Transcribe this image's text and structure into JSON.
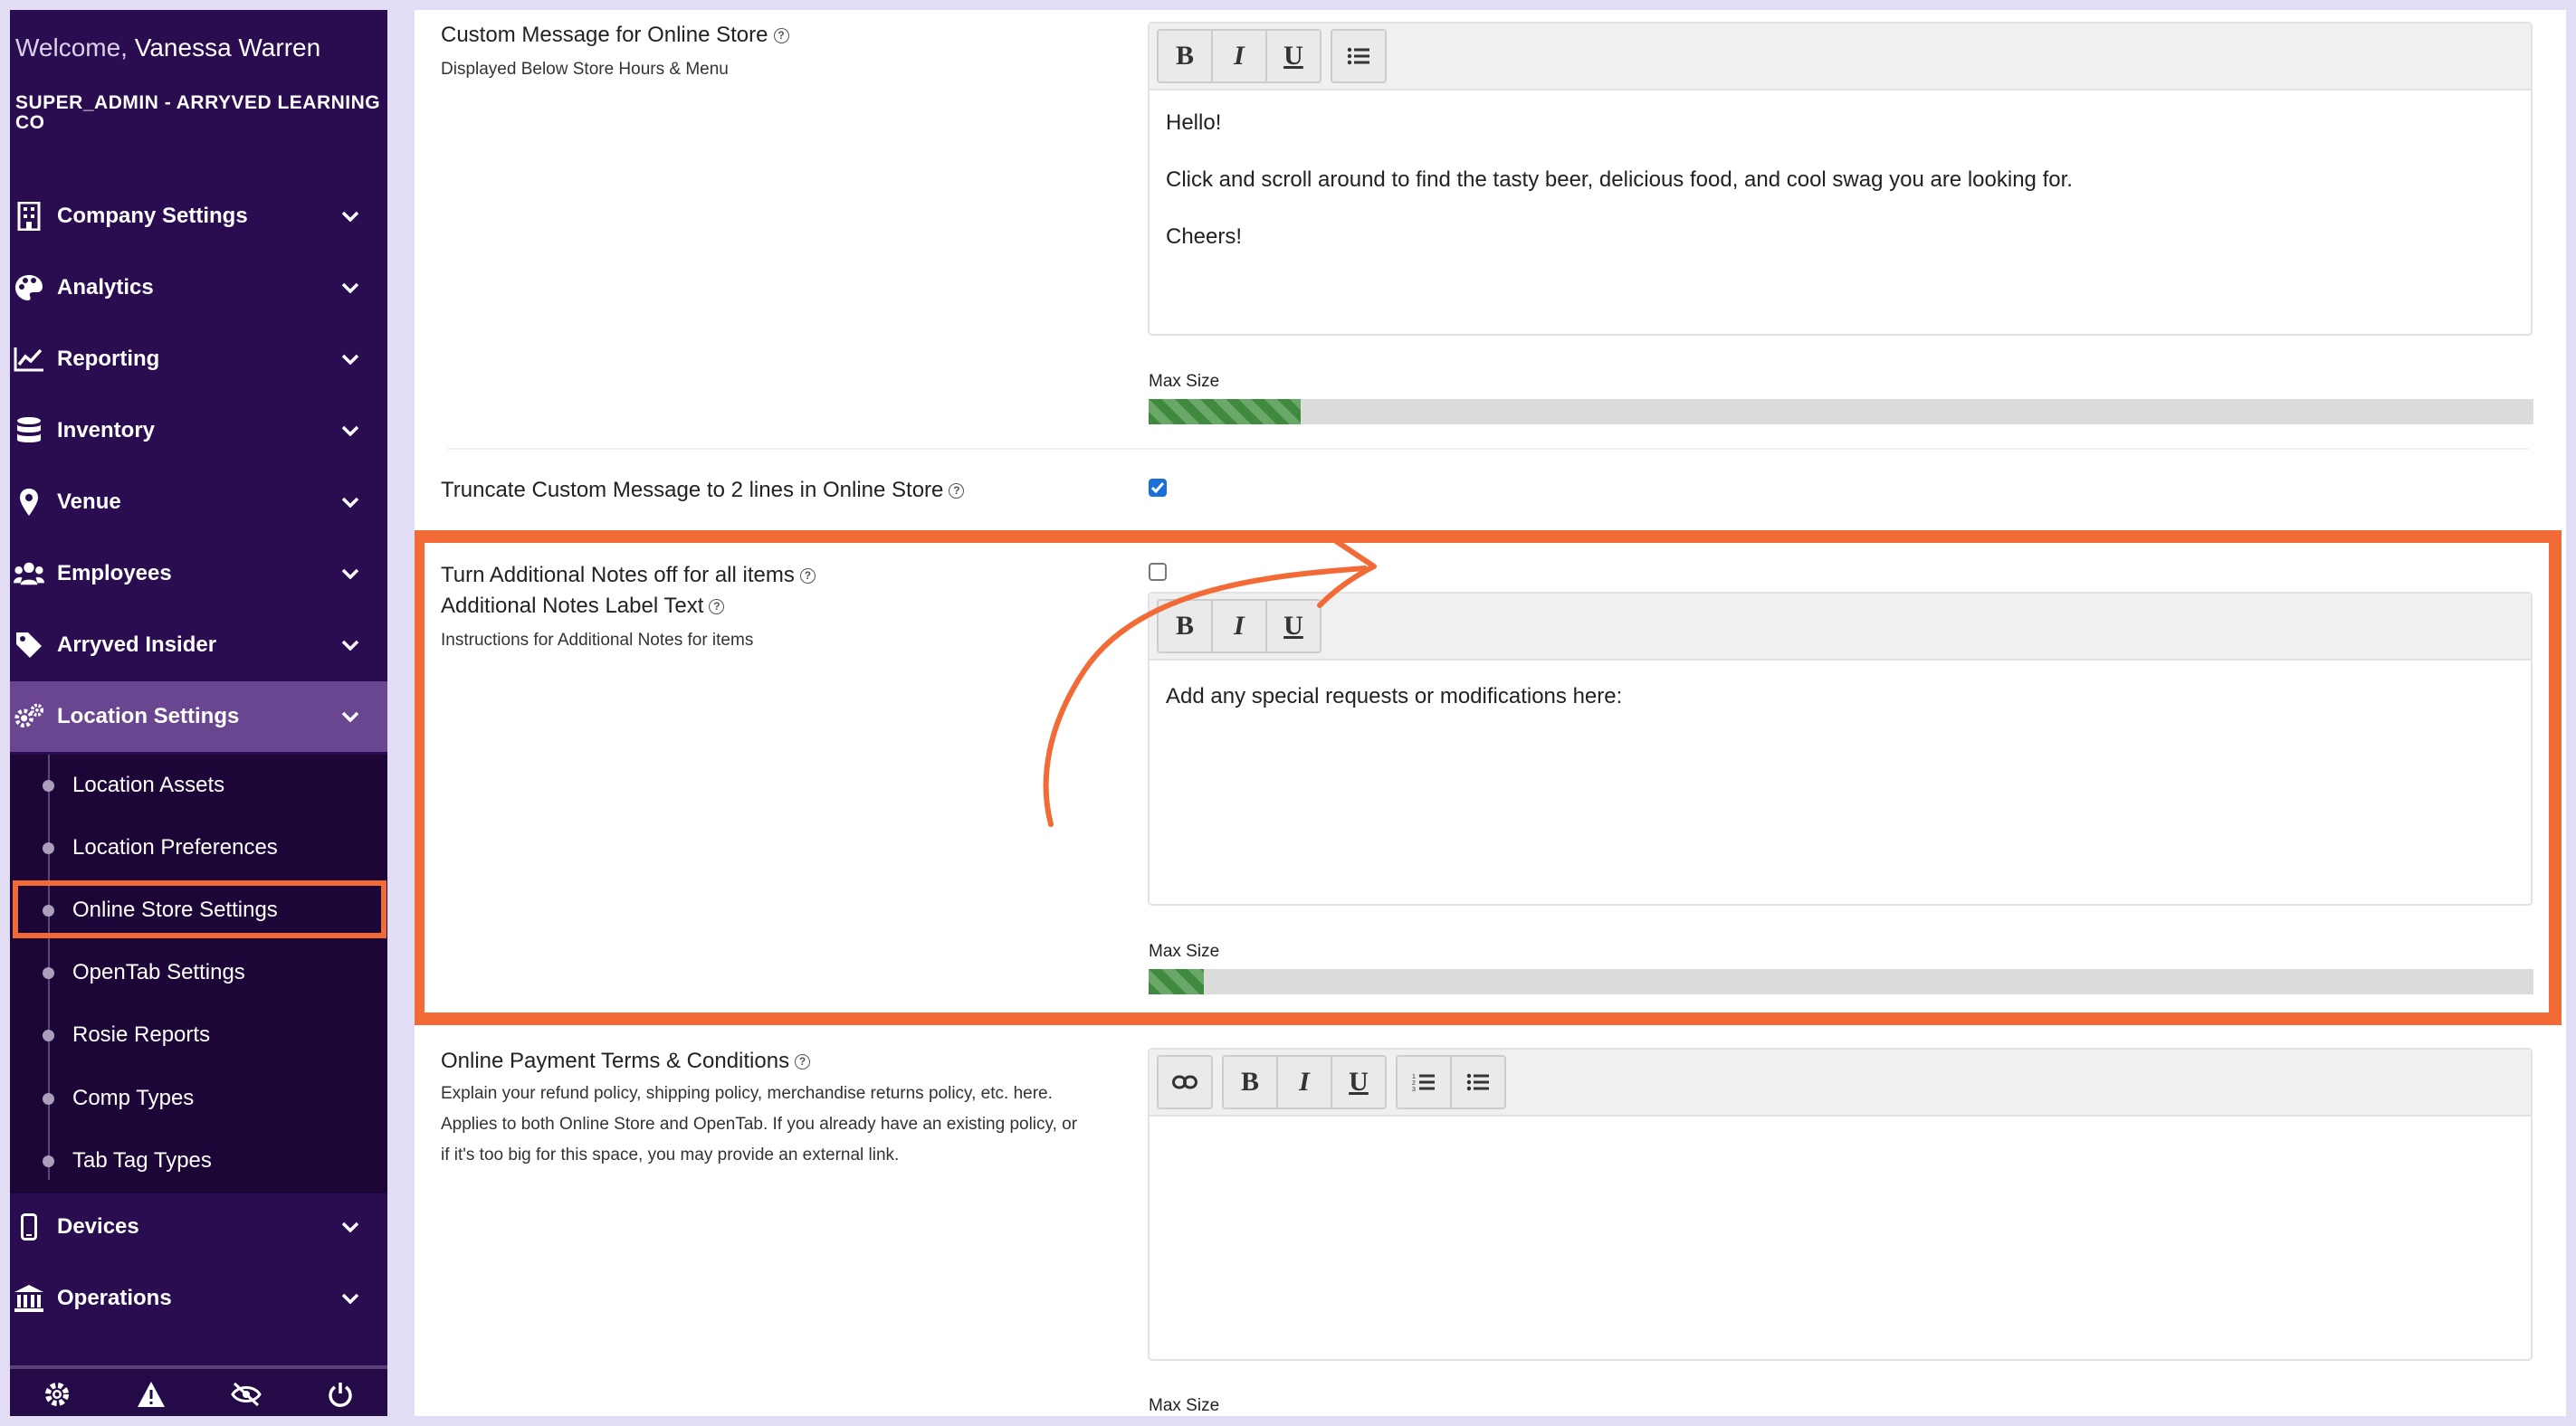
{
  "sidebar": {
    "welcome_prefix": "Welcome,",
    "user_name": "Vanessa Warren",
    "company": "SUPER_ADMIN - ARRYVED LEARNING CO",
    "nav": [
      {
        "label": "Company Settings",
        "icon": "building-icon"
      },
      {
        "label": "Analytics",
        "icon": "palette-icon"
      },
      {
        "label": "Reporting",
        "icon": "line-chart-icon"
      },
      {
        "label": "Inventory",
        "icon": "database-icon"
      },
      {
        "label": "Venue",
        "icon": "map-pin-icon"
      },
      {
        "label": "Employees",
        "icon": "users-icon"
      },
      {
        "label": "Arryved Insider",
        "icon": "tag-icon"
      },
      {
        "label": "Location Settings",
        "icon": "gears-icon",
        "active": true
      }
    ],
    "sub_items": [
      "Location Assets",
      "Location Preferences",
      "Online Store Settings",
      "OpenTab Settings",
      "Rosie Reports",
      "Comp Types",
      "Tab Tag Types"
    ],
    "nav_bottom": [
      {
        "label": "Devices",
        "icon": "mobile-icon"
      },
      {
        "label": "Operations",
        "icon": "bank-icon"
      }
    ],
    "footer_icons": [
      "gear-icon",
      "warning-icon",
      "eye-slash-icon",
      "power-icon"
    ]
  },
  "main": {
    "custom_message": {
      "label": "Custom Message for Online Store",
      "sub": "Displayed Below Store Hours & Menu",
      "lines": [
        "Hello!",
        "Click and scroll around to find the tasty beer, delicious food, and cool swag you are looking for.",
        "Cheers!"
      ],
      "max_label": "Max Size",
      "progress": 0.11
    },
    "truncate": {
      "label": "Truncate Custom Message to 2 lines in Online Store",
      "checked": true
    },
    "additional_notes_off": {
      "label": "Turn Additional Notes off for all items",
      "checked": false
    },
    "notes_label": {
      "label": "Additional Notes Label Text",
      "sub": "Instructions for Additional Notes for items",
      "text": "Add any special requests or modifications here:",
      "max_label": "Max Size",
      "progress": 0.04
    },
    "payment_terms": {
      "label": "Online Payment Terms & Conditions",
      "sub_lines": [
        "Explain your refund policy, shipping policy, merchandise returns policy, etc. here.",
        "Applies to both Online Store and OpenTab. If you already have an existing policy, or",
        "if it's too big for this space, you may provide an external link."
      ],
      "max_label": "Max Size"
    }
  },
  "colors": {
    "sidebar_bg": "#2a0c50",
    "active_nav": "#6a4590",
    "highlight": "#f26a36",
    "progress_fill": "#3f8a3f"
  }
}
